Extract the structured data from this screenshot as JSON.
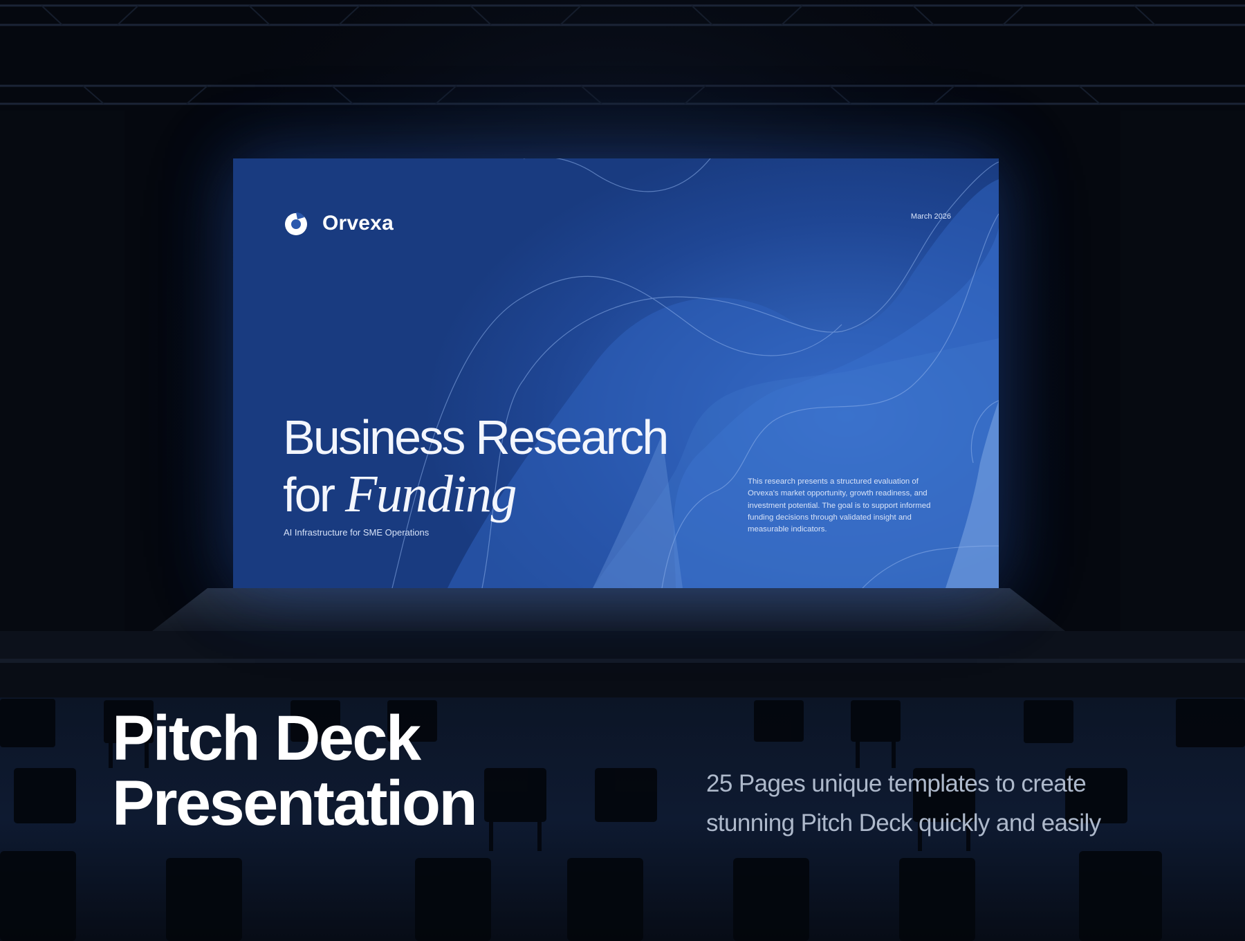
{
  "slide": {
    "brand_name": "Orvexa",
    "date": "March 2026",
    "title_line1": "Business Research",
    "title_line2_plain": "for",
    "title_line2_italic": "Funding",
    "subtitle": "AI Infrastructure for SME Operations",
    "body": "This research presents a structured evaluation of Orvexa's market opportunity, growth readiness, and investment potential. The goal is to support informed funding decisions through validated insight and measurable indicators.",
    "colors": {
      "slide_blue": "#2c5bb0",
      "slide_highlight": "#3d74cf"
    }
  },
  "promo": {
    "title_line1": "Pitch Deck",
    "title_line2": "Presentation",
    "description": "25 Pages unique templates to create stunning Pitch Deck quickly and easily"
  },
  "colors": {
    "background": "#05080f",
    "headline": "#ffffff",
    "description": "#aeb9cb"
  }
}
